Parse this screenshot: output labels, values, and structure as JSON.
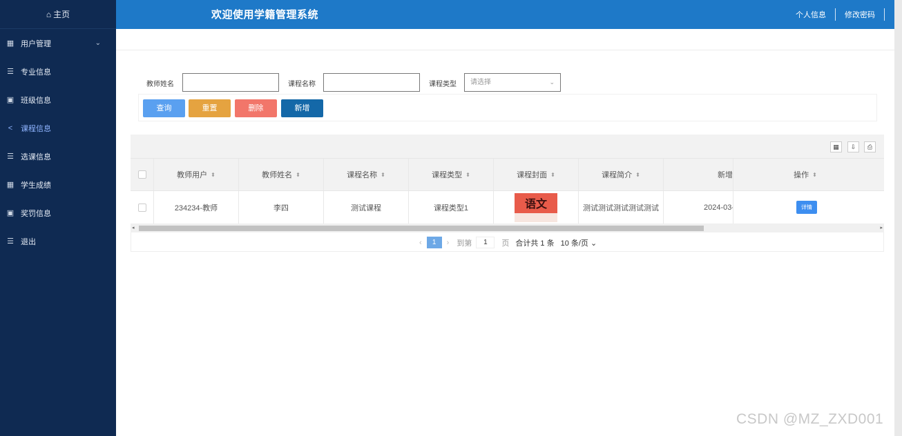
{
  "sidebar": {
    "home_label": "主页",
    "items": [
      {
        "label": "用户管理",
        "icon": "grid-icon",
        "glyph": "▦",
        "has_chevron": true
      },
      {
        "label": "专业信息",
        "icon": "list-icon",
        "glyph": "☰"
      },
      {
        "label": "班级信息",
        "icon": "book-icon",
        "glyph": "▣"
      },
      {
        "label": "课程信息",
        "icon": "share-icon",
        "glyph": "<"
      },
      {
        "label": "选课信息",
        "icon": "list-icon",
        "glyph": "☰"
      },
      {
        "label": "学生成绩",
        "icon": "grid-icon",
        "glyph": "▦"
      },
      {
        "label": "奖罚信息",
        "icon": "book-icon",
        "glyph": "▣"
      },
      {
        "label": "退出",
        "icon": "list-icon",
        "glyph": "☰"
      }
    ],
    "active_index": 3,
    "bg_color": "#0f2a52"
  },
  "header": {
    "title": "欢迎使用学籍管理系统",
    "links": [
      "个人信息",
      "修改密码"
    ],
    "bg_color": "#1e79c8"
  },
  "search": {
    "teacher_name_label": "教师姓名",
    "course_name_label": "课程名称",
    "course_type_label": "课程类型",
    "course_type_placeholder": "请选择",
    "buttons": {
      "query": "查询",
      "reset": "重置",
      "delete": "删除",
      "add": "新增"
    }
  },
  "table": {
    "columns": [
      "教师用户",
      "教师姓名",
      "课程名称",
      "课程类型",
      "课程封面",
      "课程简介",
      "新增",
      "操作"
    ],
    "rows": [
      {
        "teacher_user": "234234-教师",
        "teacher_name": "李四",
        "course_name": "测试课程",
        "course_type": "课程类型1",
        "cover_text": "语文",
        "intro": "测试测试测试测试测试",
        "added": "2024-03-",
        "action": "详情"
      }
    ]
  },
  "pagination": {
    "current_page": "1",
    "goto_label": "到第",
    "goto_value": "1",
    "page_unit": "页",
    "total": "合计共 1 条",
    "page_size": "10 条/页 ⌄"
  },
  "watermark": "CSDN @MZ_ZXD001"
}
